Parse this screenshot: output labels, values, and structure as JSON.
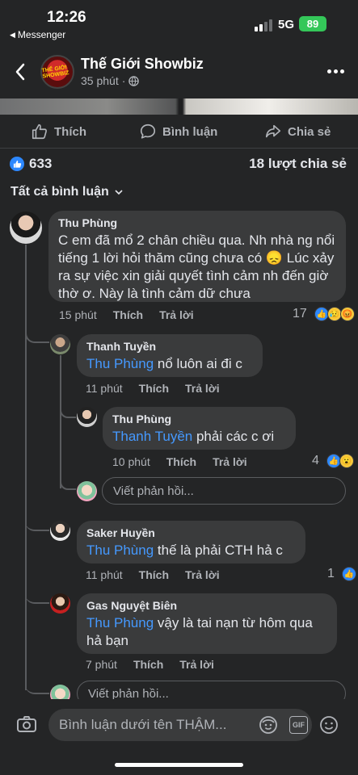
{
  "status_bar": {
    "time": "12:26",
    "back_app": "Messenger",
    "network": "5G",
    "battery": "89"
  },
  "header": {
    "page_name": "Thế Giới Showbiz",
    "time_ago": "35 phút",
    "avatar_text": "THẾ GIỚI SHOWBIZ"
  },
  "actions": {
    "like": "Thích",
    "comment": "Bình luận",
    "share": "Chia sẻ"
  },
  "stats": {
    "likes": "633",
    "shares": "18 lượt chia sẻ"
  },
  "sort_label": "Tất cả bình luận",
  "comments": [
    {
      "author": "Thu Phùng",
      "text": "C em đã mổ 2 chân chiều qua. Nh nhà ng nổi tiếng 1 lời hỏi thăm cũng chưa có 😞 Lúc xảy ra sự việc xin giải quyết tình cảm nh đến giờ thờ ơ. Này là tình cảm dữ chưa",
      "time": "15 phút",
      "like": "Thích",
      "reply": "Trả lời",
      "reactions": "17"
    },
    {
      "author": "Thanh Tuyền",
      "mention": "Thu Phùng",
      "text": " nổ luôn ai đi c",
      "time": "11 phút",
      "like": "Thích",
      "reply": "Trả lời"
    },
    {
      "author": "Thu Phùng",
      "mention": "Thanh Tuyền",
      "text": " phải các c ơi",
      "time": "10 phút",
      "like": "Thích",
      "reply": "Trả lời",
      "reactions": "4"
    },
    {
      "author": "Saker Huyền",
      "mention": "Thu Phùng",
      "text": " thế là phải CTH hả c",
      "time": "11 phút",
      "like": "Thích",
      "reply": "Trả lời",
      "reactions": "1"
    },
    {
      "author": "Gas Nguyệt Biên",
      "mention": "Thu Phùng",
      "text": " vậy là tai nạn từ hôm qua hả bạn",
      "time": "7 phút",
      "like": "Thích",
      "reply": "Trả lời"
    }
  ],
  "reply_placeholder": "Viết phản hồi...",
  "composer_placeholder": "Bình luận dưới tên THẬM...",
  "colors": {
    "accent": "#2d88ff",
    "mention": "#4599ff",
    "bubble": "#3a3b3c",
    "background": "#242526"
  }
}
